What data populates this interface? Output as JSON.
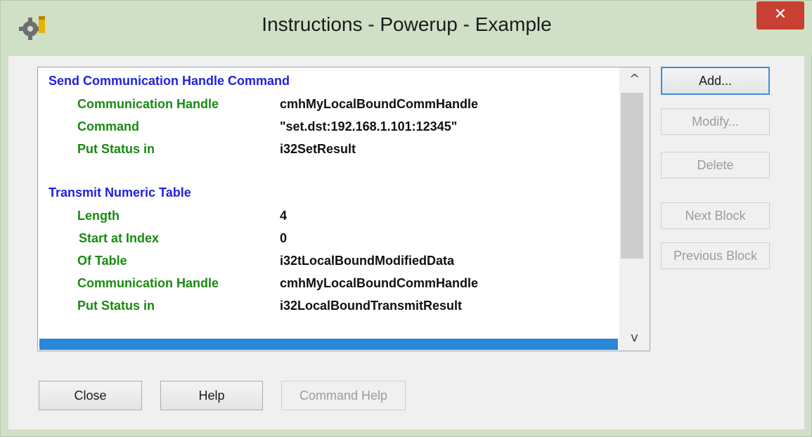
{
  "window": {
    "title": "Instructions - Powerup - Example",
    "close_glyph": "✕",
    "accent": "#c84031"
  },
  "list": {
    "sections": [
      {
        "header": "Send Communication Handle Command",
        "rows": [
          {
            "label": "Communication Handle",
            "value": "cmhMyLocalBoundCommHandle"
          },
          {
            "label": "Command",
            "value": "\"set.dst:192.168.1.101:12345\""
          },
          {
            "label": "Put Status in",
            "value": "i32SetResult"
          }
        ]
      },
      {
        "header": "Transmit Numeric Table",
        "rows": [
          {
            "label": "Length",
            "value": "4"
          },
          {
            "label": "Start at Index",
            "value": "0"
          },
          {
            "label": "Of Table",
            "value": "i32tLocalBoundModifiedData"
          },
          {
            "label": "Communication Handle",
            "value": "cmhMyLocalBoundCommHandle"
          },
          {
            "label": "Put Status in",
            "value": "i32LocalBoundTransmitResult"
          }
        ]
      }
    ],
    "scroll_up_glyph": "^",
    "scroll_down_glyph": "v",
    "header_color": "#1f1fe0",
    "label_color": "#1a8a12",
    "selection_color": "#2b88d8"
  },
  "buttons": {
    "add": "Add...",
    "modify": "Modify...",
    "delete": "Delete",
    "next_block": "Next Block",
    "previous_block": "Previous Block",
    "close": "Close",
    "help": "Help",
    "command_help": "Command Help"
  }
}
